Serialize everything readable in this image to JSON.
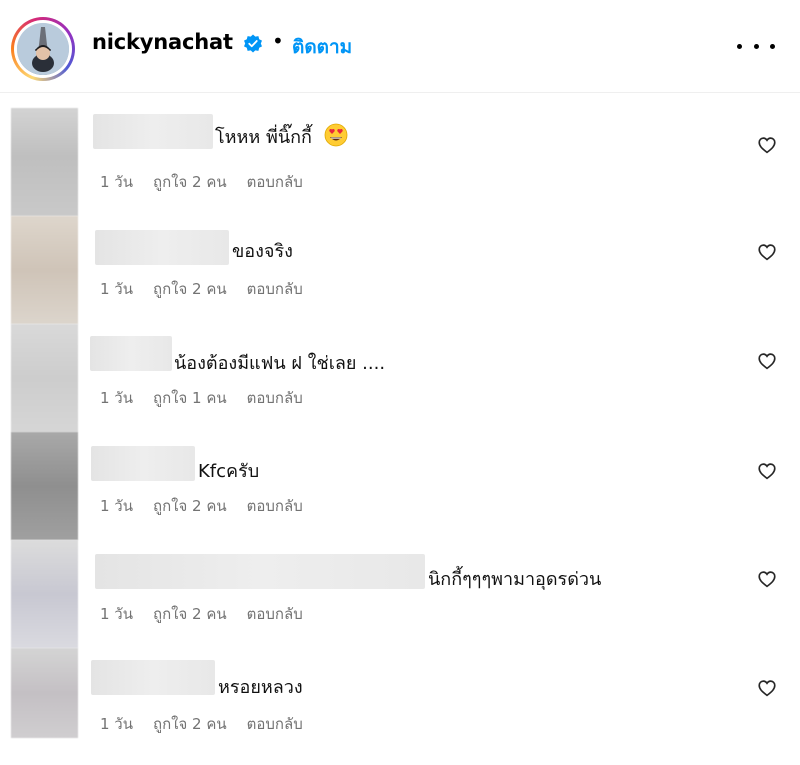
{
  "header": {
    "username": "nickynachat",
    "separator": "•",
    "follow_label": "ติดตาม"
  },
  "icons": {
    "verified": "verified-badge-icon",
    "more": "more-options-icon",
    "like": "heart-outline-icon",
    "emoji": "heart-eyes-emoji"
  },
  "colors": {
    "accent": "#0095f6",
    "verified": "#0095f6",
    "meta_text": "#737373"
  },
  "comments": [
    {
      "text": "โหหห พี่นิ๊กกี้",
      "has_emoji": true,
      "time": "1 วัน",
      "likes": "ถูกใจ 2 คน",
      "reply": "ตอบกลับ"
    },
    {
      "text": "ของจริง",
      "has_emoji": false,
      "time": "1 วัน",
      "likes": "ถูกใจ 2 คน",
      "reply": "ตอบกลับ"
    },
    {
      "text": "น้องต้องมีแฟน ฝ ใช่เลย ....",
      "has_emoji": false,
      "time": "1 วัน",
      "likes": "ถูกใจ 1 คน",
      "reply": "ตอบกลับ"
    },
    {
      "text": "Kfcครับ",
      "has_emoji": false,
      "time": "1 วัน",
      "likes": "ถูกใจ 2 คน",
      "reply": "ตอบกลับ"
    },
    {
      "text": "นิกกี้ๆๆๆพามาอุดรด่วน",
      "has_emoji": false,
      "time": "1 วัน",
      "likes": "ถูกใจ 2 คน",
      "reply": "ตอบกลับ"
    },
    {
      "text": "หรอยหลวง",
      "has_emoji": false,
      "time": "1 วัน",
      "likes": "ถูกใจ 2 คน",
      "reply": "ตอบกลับ"
    }
  ]
}
